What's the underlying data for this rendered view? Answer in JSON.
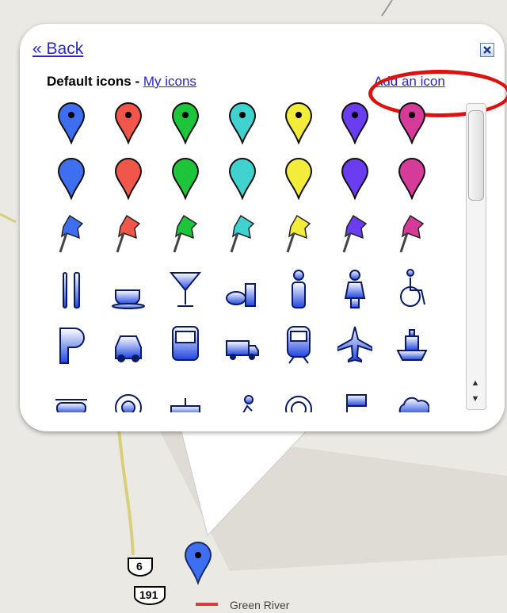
{
  "popup": {
    "back_label": "« Back",
    "default_icons_label": "Default icons -",
    "my_icons_label": "My icons",
    "add_icon_label": "Add an icon"
  },
  "colors": {
    "blue": "#3d6ff0",
    "red": "#f0564a",
    "green": "#1ec43a",
    "teal": "#3fd2cf",
    "yellow": "#f4ec3a",
    "purple": "#6a3df0",
    "pink": "#d63b9a",
    "link": "#2a26c9"
  },
  "icon_rows": [
    {
      "kind": "dot-marker",
      "colors": [
        "blue",
        "red",
        "green",
        "teal",
        "yellow",
        "purple",
        "pink"
      ]
    },
    {
      "kind": "marker",
      "colors": [
        "blue",
        "red",
        "green",
        "teal",
        "yellow",
        "purple",
        "pink"
      ]
    },
    {
      "kind": "pushpin",
      "colors": [
        "blue",
        "red",
        "green",
        "teal",
        "yellow",
        "purple",
        "pink"
      ]
    },
    {
      "kind": "symbols",
      "names": [
        "restaurant-icon",
        "cafe-icon",
        "bar-icon",
        "fast-food-icon",
        "mens-restroom-icon",
        "womens-restroom-icon",
        "wheelchair-icon"
      ]
    },
    {
      "kind": "symbols",
      "names": [
        "parking-icon",
        "taxi-icon",
        "bus-icon",
        "truck-icon",
        "train-icon",
        "airport-icon",
        "ferry-icon"
      ]
    },
    {
      "kind": "symbols",
      "names": [
        "helicopter-icon",
        "target-icon",
        "rail-icon",
        "hiker-icon",
        "spiral-icon",
        "flag-icon",
        "cloud-icon"
      ]
    }
  ],
  "map": {
    "route6_label": "6",
    "route191_label": "191",
    "place_label": "Green River"
  }
}
